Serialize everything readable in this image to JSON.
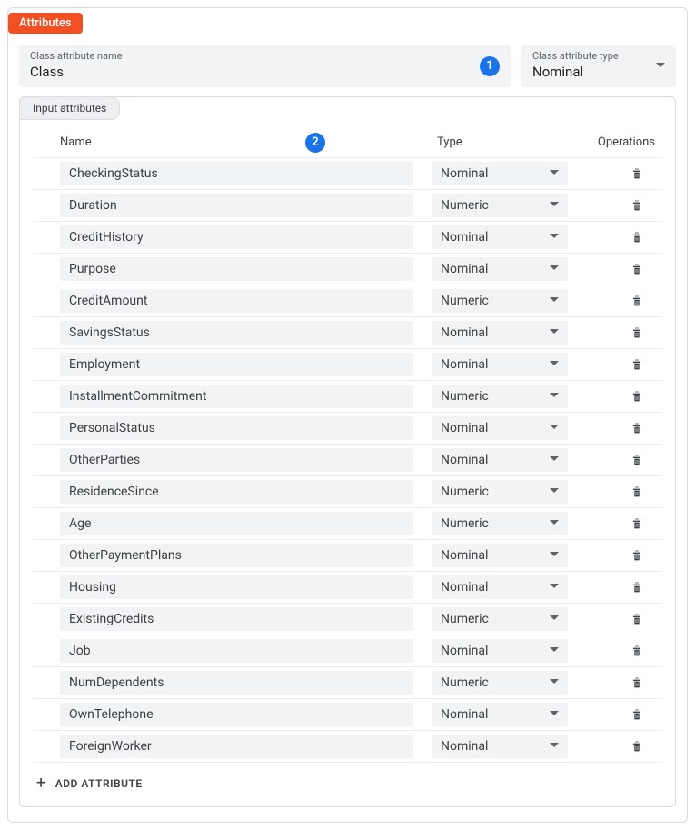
{
  "header": {
    "title": "Attributes"
  },
  "classAttr": {
    "name_label": "Class attribute name",
    "name_value": "Class",
    "type_label": "Class attribute type",
    "type_value": "Nominal"
  },
  "callouts": {
    "one": "1",
    "two": "2"
  },
  "tab": {
    "label": "Input attributes"
  },
  "columns": {
    "name": "Name",
    "type": "Type",
    "ops": "Operations"
  },
  "add": {
    "label": "ADD ATTRIBUTE"
  },
  "rows": [
    {
      "name": "CheckingStatus",
      "type": "Nominal"
    },
    {
      "name": "Duration",
      "type": "Numeric"
    },
    {
      "name": "CreditHistory",
      "type": "Nominal"
    },
    {
      "name": "Purpose",
      "type": "Nominal"
    },
    {
      "name": "CreditAmount",
      "type": "Numeric"
    },
    {
      "name": "SavingsStatus",
      "type": "Nominal"
    },
    {
      "name": "Employment",
      "type": "Nominal"
    },
    {
      "name": "InstallmentCommitment",
      "type": "Numeric"
    },
    {
      "name": "PersonalStatus",
      "type": "Nominal"
    },
    {
      "name": "OtherParties",
      "type": "Nominal"
    },
    {
      "name": "ResidenceSince",
      "type": "Numeric"
    },
    {
      "name": "Age",
      "type": "Numeric"
    },
    {
      "name": "OtherPaymentPlans",
      "type": "Nominal"
    },
    {
      "name": "Housing",
      "type": "Nominal"
    },
    {
      "name": "ExistingCredits",
      "type": "Numeric"
    },
    {
      "name": "Job",
      "type": "Nominal"
    },
    {
      "name": "NumDependents",
      "type": "Numeric"
    },
    {
      "name": "OwnTelephone",
      "type": "Nominal"
    },
    {
      "name": "ForeignWorker",
      "type": "Nominal"
    }
  ]
}
